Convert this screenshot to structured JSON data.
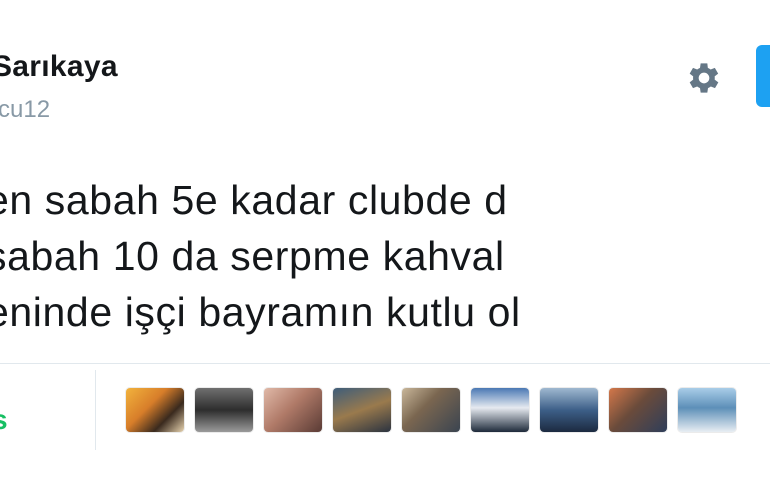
{
  "user": {
    "display_name": "Sarıkaya",
    "handle": "cu12"
  },
  "tweet": {
    "lines": [
      "en sabah 5e kadar clubde d",
      "sabah 10 da serpme kahval",
      "eninde işçi bayramın kutlu ol"
    ]
  },
  "stats": {
    "count_fragment": "s"
  },
  "icons": {
    "gear": "gear-icon"
  },
  "colors": {
    "accent": "#1da1f2",
    "count_green": "#17bf63",
    "handle_gray": "#8899a6",
    "divider": "#e1e8ed"
  },
  "avatars": [
    {
      "name": "liker-avatar-1",
      "bg": "linear-gradient(135deg,#f2b33d 0%,#d87e2a 40%,#3a2a1e 70%,#e8d4b0 100%)"
    },
    {
      "name": "liker-avatar-2",
      "bg": "linear-gradient(180deg,#6f6f6f 0%,#2d2d2d 50%,#9a9a9a 100%)"
    },
    {
      "name": "liker-avatar-3",
      "bg": "linear-gradient(135deg,#e0b9a8 0%,#b07a68 45%,#5a3b35 100%)"
    },
    {
      "name": "liker-avatar-4",
      "bg": "linear-gradient(160deg,#3e5d7a 0%,#9a7a4d 50%,#2b3340 100%)"
    },
    {
      "name": "liker-avatar-5",
      "bg": "linear-gradient(135deg,#c9b79a 0%,#7a6650 40%,#3a4450 100%)"
    },
    {
      "name": "liker-avatar-6",
      "bg": "linear-gradient(180deg,#4a78b4 0%,#e6eaf0 45%,#1e2a3a 100%)"
    },
    {
      "name": "liker-avatar-7",
      "bg": "linear-gradient(180deg,#9fb8d0 0%,#3d5f88 50%,#1c2a40 100%)"
    },
    {
      "name": "liker-avatar-8",
      "bg": "linear-gradient(135deg,#d4784a 0%,#6a4b3b 45%,#2e3e5a 100%)"
    },
    {
      "name": "liker-avatar-9",
      "bg": "linear-gradient(180deg,#a9cde8 0%,#5d8fb8 45%,#e8eef3 100%)"
    }
  ]
}
